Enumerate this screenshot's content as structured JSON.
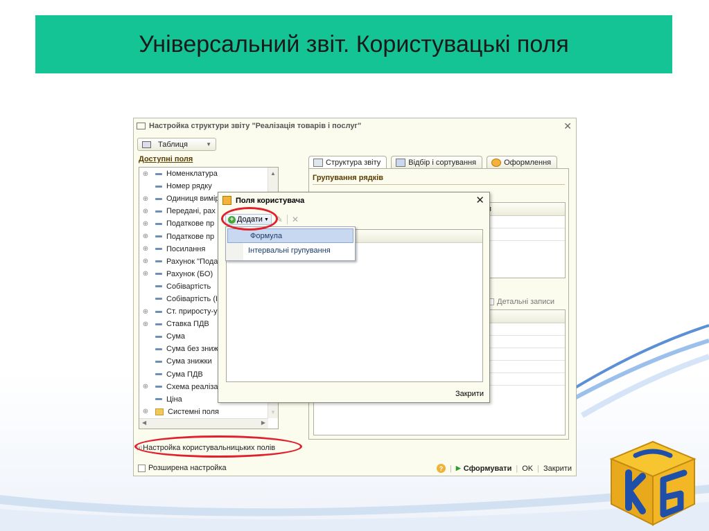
{
  "slide": {
    "title": "Універсальний звіт. Користувацькі поля"
  },
  "window": {
    "title": "Настройка структури звіту \"Реалізація товарів і послуг\""
  },
  "view_mode": {
    "selected": "Таблиця"
  },
  "available_fields": {
    "label": "Доступні поля",
    "items": [
      {
        "label": "Номенклатура",
        "expandable": true
      },
      {
        "label": "Номер рядку",
        "expandable": false
      },
      {
        "label": "Одиниця вимір",
        "expandable": true
      },
      {
        "label": "Передані, рах",
        "expandable": true
      },
      {
        "label": "Податкове пр",
        "expandable": true
      },
      {
        "label": "Податкове пр",
        "expandable": true
      },
      {
        "label": "Посилання",
        "expandable": true
      },
      {
        "label": "Рахунок \"Пода",
        "expandable": true
      },
      {
        "label": "Рахунок (БО)",
        "expandable": true
      },
      {
        "label": "Собівартість",
        "expandable": false
      },
      {
        "label": "Собівартість (I",
        "expandable": false
      },
      {
        "label": "Ст. приросту-у",
        "expandable": true
      },
      {
        "label": "Ставка ПДВ",
        "expandable": true
      },
      {
        "label": "Сума",
        "expandable": false
      },
      {
        "label": "Сума без зниж",
        "expandable": false
      },
      {
        "label": "Сума знижки",
        "expandable": false
      },
      {
        "label": "Сума ПДВ",
        "expandable": false
      },
      {
        "label": "Схема реаліза",
        "expandable": true
      },
      {
        "label": "Ціна",
        "expandable": false
      },
      {
        "label": "Системні поля",
        "expandable": true,
        "folder": true
      }
    ]
  },
  "custom_fields_link": {
    "label": "Настройка користувальницьких полів",
    "icon_text": "(x)"
  },
  "tabs": [
    {
      "label": "Структура звіту",
      "active": true
    },
    {
      "label": "Відбір і сортування",
      "active": false
    },
    {
      "label": "Оформлення",
      "active": false
    }
  ],
  "structure": {
    "row_grouping_label": "Групування рядків",
    "grid_head_fragment": "я",
    "detail_records": "Детальні записи"
  },
  "dialog": {
    "title": "Поля користувача",
    "add_label": "Додати",
    "close_label": "Закрити",
    "menu": [
      {
        "label": "Формула",
        "highlighted": true
      },
      {
        "label": "Інтервальні групування",
        "highlighted": false
      }
    ]
  },
  "bottom": {
    "extended_setting": "Розширена настройка",
    "help": "?",
    "generate": "Сформувати",
    "ok": "OK",
    "close": "Закрити"
  },
  "colors": {
    "title_bar": "#14c495",
    "marker": "#e0202c",
    "window_bg": "#fbfbee"
  }
}
